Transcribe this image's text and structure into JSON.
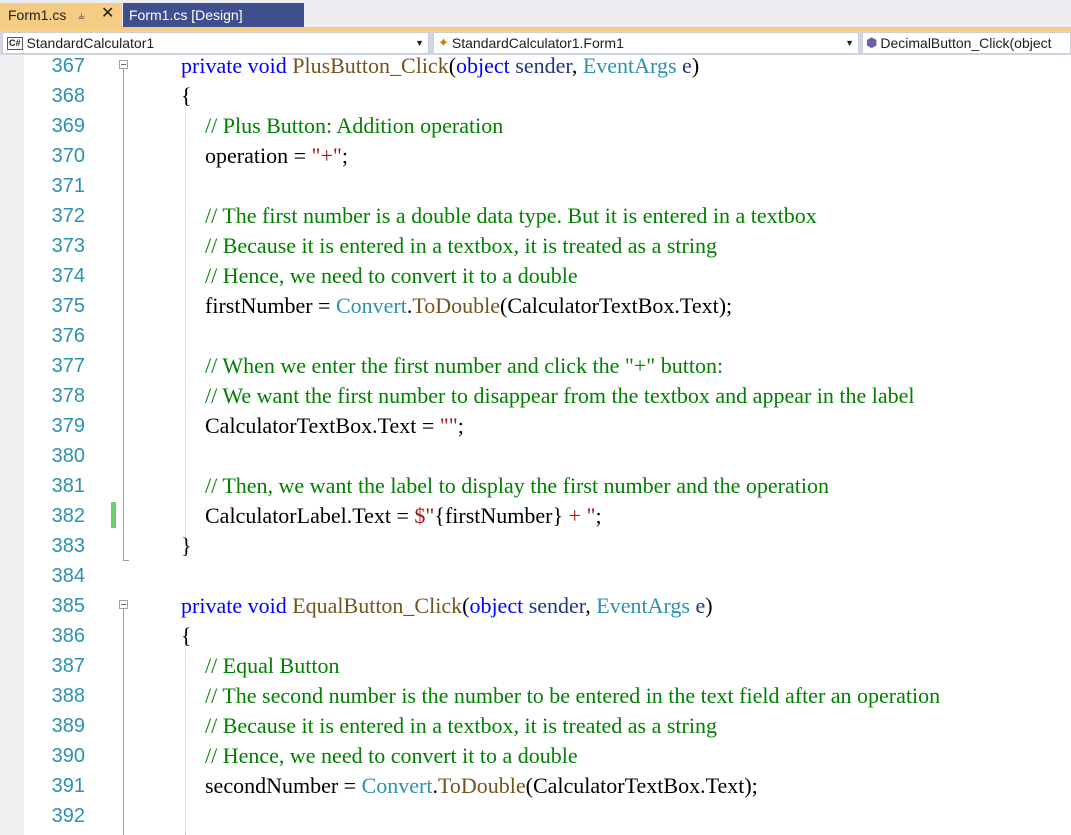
{
  "tabs": [
    {
      "label": "Form1.cs",
      "active": true,
      "pin_icon": "pin-icon",
      "close_icon": "close-icon"
    },
    {
      "label": "Form1.cs [Design]",
      "active": false
    }
  ],
  "navbar": {
    "project": "StandardCalculator1",
    "project_badge": "C#",
    "type": "StandardCalculator1.Form1",
    "member": "DecimalButton_Click(object"
  },
  "colors": {
    "keyword": "#0000ff",
    "type": "#2b91af",
    "method": "#74531f",
    "comment": "#008000",
    "string": "#a31515",
    "line_number": "#2b91af",
    "active_tab": "#f5cc84",
    "inactive_tab": "#3f4e8c",
    "change_marker": "#6bd06b"
  },
  "editor": {
    "line_numbers": [
      "367",
      "368",
      "369",
      "370",
      "371",
      "372",
      "373",
      "374",
      "375",
      "376",
      "377",
      "378",
      "379",
      "380",
      "381",
      "382",
      "383",
      "384",
      "385",
      "386",
      "387",
      "388",
      "389",
      "390",
      "391",
      "392"
    ],
    "lines": [
      {
        "n": "367",
        "parts": [
          [
            "kw",
            "private"
          ],
          [
            "",
            " "
          ],
          [
            "kw",
            "void"
          ],
          [
            "",
            " "
          ],
          [
            "me",
            "PlusButton_Click"
          ],
          [
            "",
            "("
          ],
          [
            "kw",
            "object"
          ],
          [
            "",
            ""
          ],
          [
            "pa",
            " sender"
          ],
          [
            "",
            ", "
          ],
          [
            "ty",
            "EventArgs"
          ],
          [
            "pa",
            " e"
          ],
          [
            "",
            ")"
          ]
        ]
      },
      {
        "n": "368",
        "parts": [
          [
            "",
            "{"
          ]
        ]
      },
      {
        "n": "369",
        "parts": [
          [
            "cm",
            "// Plus Button: Addition operation"
          ]
        ]
      },
      {
        "n": "370",
        "parts": [
          [
            "",
            "operation = "
          ],
          [
            "st",
            "\"+\""
          ],
          [
            "",
            ";"
          ]
        ]
      },
      {
        "n": "371",
        "parts": []
      },
      {
        "n": "372",
        "parts": [
          [
            "cm",
            "// The first number is a double data type. But it is entered in a textbox"
          ]
        ]
      },
      {
        "n": "373",
        "parts": [
          [
            "cm",
            "// Because it is entered in a textbox, it is treated as a string"
          ]
        ]
      },
      {
        "n": "374",
        "parts": [
          [
            "cm",
            "// Hence, we need to convert it to a double"
          ]
        ]
      },
      {
        "n": "375",
        "parts": [
          [
            "",
            "firstNumber = "
          ],
          [
            "ty",
            "Convert"
          ],
          [
            "",
            "."
          ],
          [
            "me",
            "ToDouble"
          ],
          [
            "",
            "(CalculatorTextBox.Text);"
          ]
        ]
      },
      {
        "n": "376",
        "parts": []
      },
      {
        "n": "377",
        "parts": [
          [
            "cm",
            "// When we enter the first number and click the \"+\" button:"
          ]
        ]
      },
      {
        "n": "378",
        "parts": [
          [
            "cm",
            "// We want the first number to disappear from the textbox and appear in the label"
          ]
        ]
      },
      {
        "n": "379",
        "parts": [
          [
            "",
            "CalculatorTextBox.Text = "
          ],
          [
            "st",
            "\"\""
          ],
          [
            "",
            ";"
          ]
        ]
      },
      {
        "n": "380",
        "parts": []
      },
      {
        "n": "381",
        "parts": [
          [
            "cm",
            "// Then, we want the label to display the first number and the operation"
          ]
        ]
      },
      {
        "n": "382",
        "parts": [
          [
            "",
            "CalculatorLabel.Text = "
          ],
          [
            "st",
            "$\""
          ],
          [
            "",
            "{firstNumber}"
          ],
          [
            "st",
            " + \""
          ],
          [
            "",
            ";"
          ]
        ]
      },
      {
        "n": "383",
        "parts": [
          [
            "",
            "}"
          ]
        ]
      },
      {
        "n": "384",
        "parts": []
      },
      {
        "n": "385",
        "parts": [
          [
            "kw",
            "private"
          ],
          [
            "",
            " "
          ],
          [
            "kw",
            "void"
          ],
          [
            "",
            " "
          ],
          [
            "me",
            "EqualButton_Click"
          ],
          [
            "",
            "("
          ],
          [
            "kw",
            "object"
          ],
          [
            "pa",
            " sender"
          ],
          [
            "",
            ", "
          ],
          [
            "ty",
            "EventArgs"
          ],
          [
            "pa",
            " e"
          ],
          [
            "",
            ")"
          ]
        ]
      },
      {
        "n": "386",
        "parts": [
          [
            "",
            "{"
          ]
        ]
      },
      {
        "n": "387",
        "parts": [
          [
            "cm",
            "// Equal Button"
          ]
        ]
      },
      {
        "n": "388",
        "parts": [
          [
            "cm",
            "// The second number is the number to be entered in the text field after an operation"
          ]
        ]
      },
      {
        "n": "389",
        "parts": [
          [
            "cm",
            "// Because it is entered in a textbox, it is treated as a string"
          ]
        ]
      },
      {
        "n": "390",
        "parts": [
          [
            "cm",
            "// Hence, we need to convert it to a double"
          ]
        ]
      },
      {
        "n": "391",
        "parts": [
          [
            "",
            "secondNumber = "
          ],
          [
            "ty",
            "Convert"
          ],
          [
            "",
            "."
          ],
          [
            "me",
            "ToDouble"
          ],
          [
            "",
            "(CalculatorTextBox.Text);"
          ]
        ]
      },
      {
        "n": "392",
        "parts": []
      }
    ]
  }
}
